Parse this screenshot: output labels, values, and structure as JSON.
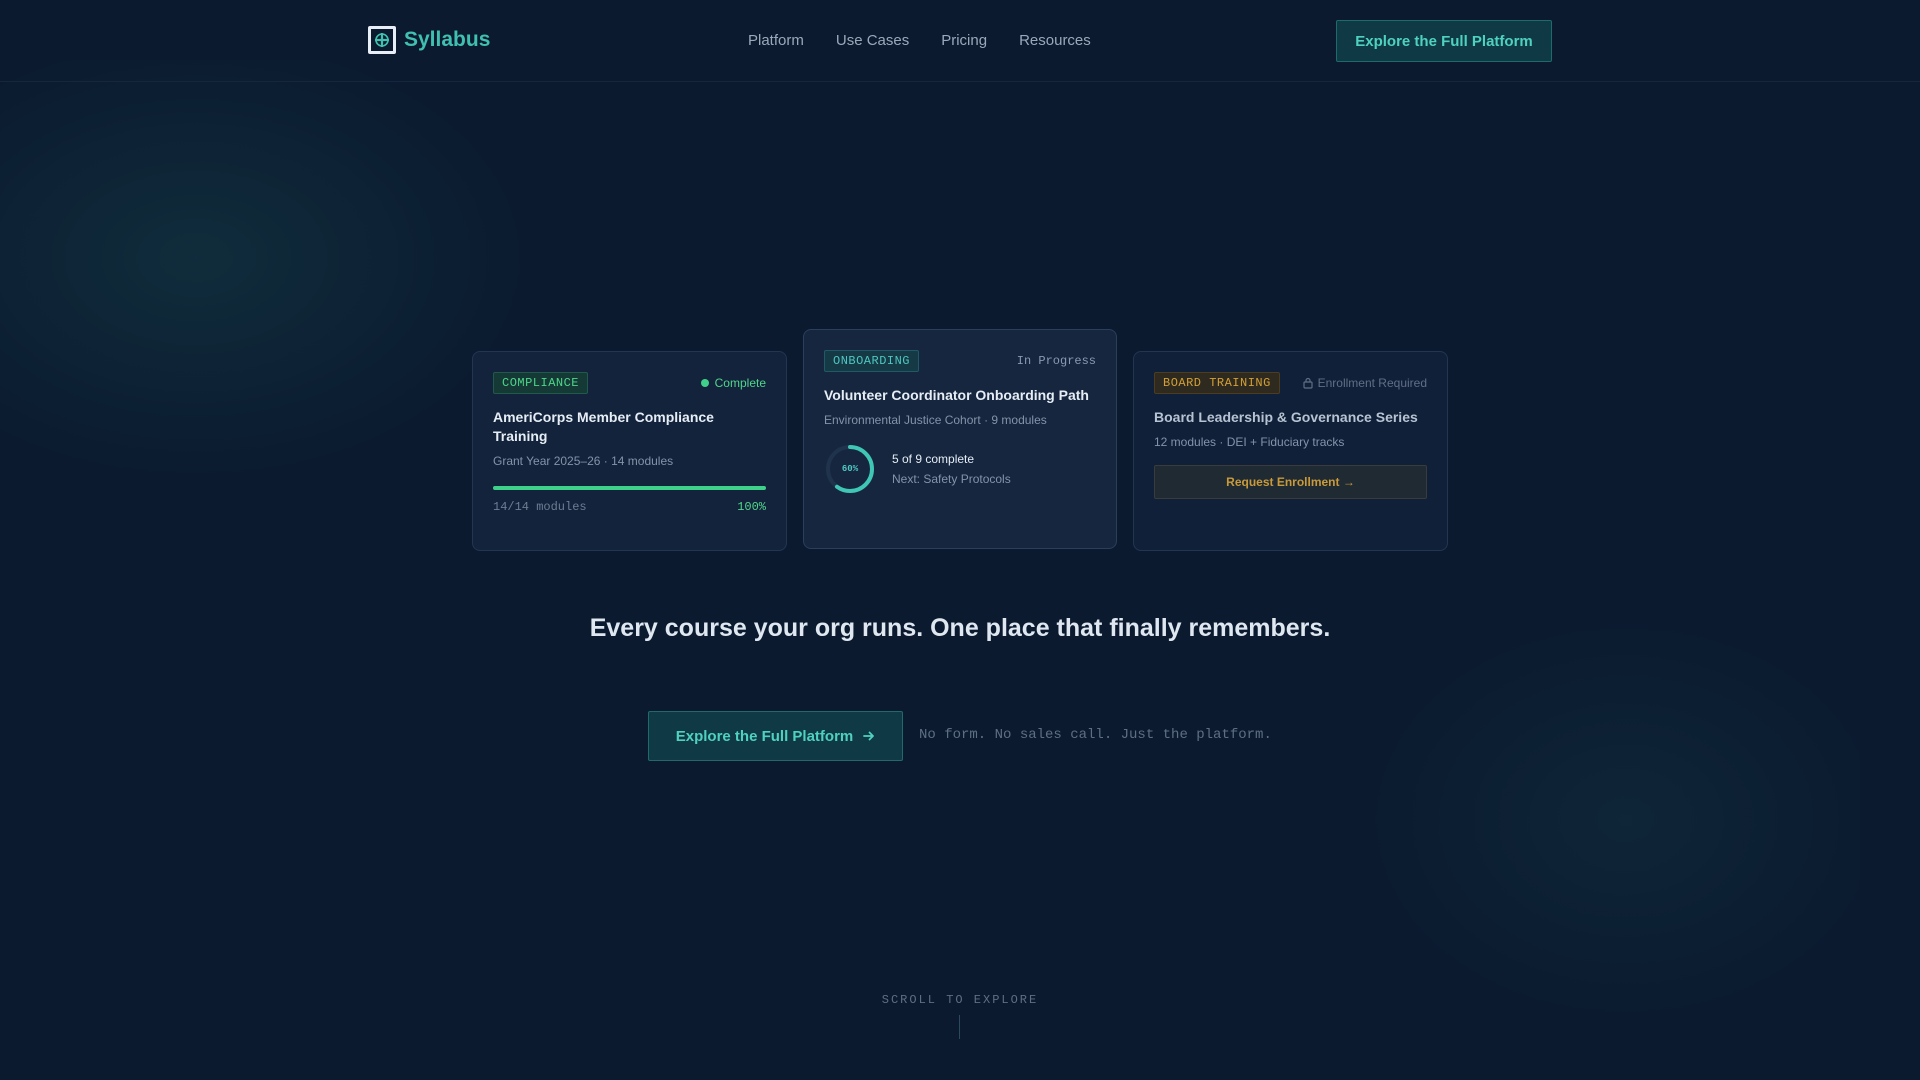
{
  "nav": {
    "brand": "Syllabus",
    "links": [
      "Platform",
      "Use Cases",
      "Pricing",
      "Resources"
    ],
    "cta": "Explore the Full Platform"
  },
  "cards": [
    {
      "tag": "COMPLIANCE",
      "status": "Complete",
      "title": "AmeriCorps Member Compliance Training",
      "meta": "Grant Year 2025–26 · 14 modules",
      "progress_fraction": 1.0,
      "progress_left": "14/14 modules",
      "progress_right": "100%"
    },
    {
      "tag": "ONBOARDING",
      "status": "In Progress",
      "title": "Volunteer Coordinator Onboarding Path",
      "meta": "Environmental Justice Cohort · 9 modules",
      "ring_percent": 60,
      "ring_label": "60%",
      "ring_line1": "5 of 9 complete",
      "ring_line2": "Next: Safety Protocols"
    },
    {
      "tag": "BOARD TRAINING",
      "status": "Enrollment Required",
      "title": "Board Leadership & Governance Series",
      "meta": "12 modules · DEI + Fiduciary tracks",
      "button": "Request Enrollment →"
    }
  ],
  "hero": {
    "headline": "Every course your org runs. One place that finally remembers.",
    "cta": "Explore the Full Platform",
    "cta_icon": "arrow-right-icon",
    "note": "No form. No sales call. Just the platform."
  },
  "scroll_label": "SCROLL TO EXPLORE",
  "colors": {
    "background": "#0b1a2f",
    "accent_teal": "#4fd1c0",
    "accent_green": "#3fd18a",
    "accent_amber": "#d4a033"
  }
}
